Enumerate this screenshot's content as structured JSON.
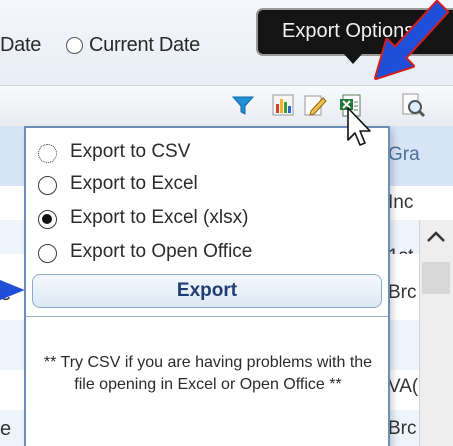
{
  "filter_bar": {
    "date_label": "Date",
    "current_date_label": "Current Date"
  },
  "tooltip": {
    "text": "Export Options"
  },
  "toolbar": {
    "icons": [
      "filter-icon",
      "chart-icon",
      "edit-icon",
      "excel-export-icon",
      "print-preview-icon"
    ]
  },
  "grid": {
    "header_fragment": "Gra",
    "row_fragments": [
      "Inc",
      "1st",
      "Brc",
      "VA(",
      "Brc"
    ],
    "left_fragments": [
      "e",
      "e"
    ]
  },
  "export_panel": {
    "options": [
      {
        "label": "Export to CSV",
        "selected": false
      },
      {
        "label": "Export to Excel",
        "selected": false
      },
      {
        "label": "Export to Excel (xlsx)",
        "selected": true
      },
      {
        "label": "Export to Open Office",
        "selected": false
      }
    ],
    "export_button_label": "Export",
    "note": "** Try CSV if you are having problems with the file opening in Excel or Open Office **"
  },
  "colors": {
    "annotation_arrow": "#1f4ed8",
    "annotation_arrow_outline": "#d21f1f",
    "tooltip_bg": "#141414",
    "panel_border": "#6b8db8"
  }
}
